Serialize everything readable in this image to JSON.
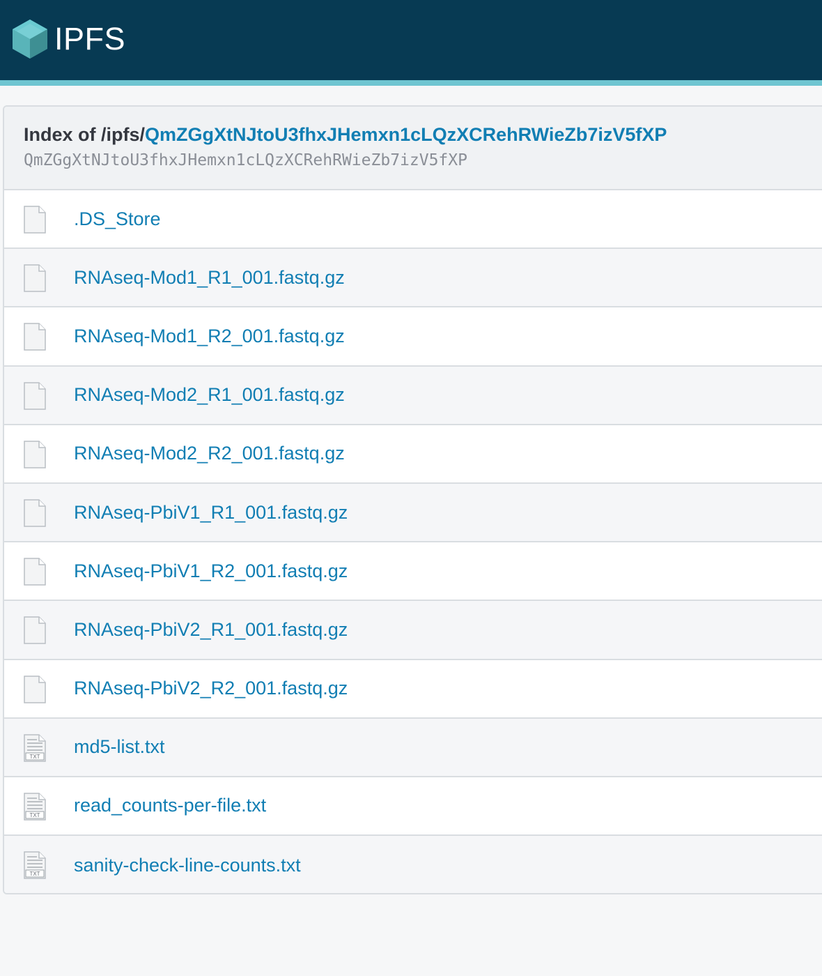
{
  "header": {
    "logo_text": "IPFS",
    "brand_color": "#073a53",
    "stripe_color": "#6fc5d1"
  },
  "index": {
    "prefix": "Index of /ipfs/",
    "cid_link": "QmZGgXtNJtoU3fhxJHemxn1cLQzXCRehRWieZb7izV5fXP",
    "cid_hash": "QmZGgXtNJtoU3fhxJHemxn1cLQzXCRehRWieZb7izV5fXP"
  },
  "files": [
    {
      "name": ".DS_Store",
      "icon": "file-icon"
    },
    {
      "name": "RNAseq-Mod1_R1_001.fastq.gz",
      "icon": "file-icon"
    },
    {
      "name": "RNAseq-Mod1_R2_001.fastq.gz",
      "icon": "file-icon"
    },
    {
      "name": "RNAseq-Mod2_R1_001.fastq.gz",
      "icon": "file-icon"
    },
    {
      "name": "RNAseq-Mod2_R2_001.fastq.gz",
      "icon": "file-icon"
    },
    {
      "name": "RNAseq-PbiV1_R1_001.fastq.gz",
      "icon": "file-icon"
    },
    {
      "name": "RNAseq-PbiV1_R2_001.fastq.gz",
      "icon": "file-icon"
    },
    {
      "name": "RNAseq-PbiV2_R1_001.fastq.gz",
      "icon": "file-icon"
    },
    {
      "name": "RNAseq-PbiV2_R2_001.fastq.gz",
      "icon": "file-icon"
    },
    {
      "name": "md5-list.txt",
      "icon": "txt-file-icon",
      "icon_label": "TXT"
    },
    {
      "name": "read_counts-per-file.txt",
      "icon": "txt-file-icon",
      "icon_label": "TXT"
    },
    {
      "name": "sanity-check-line-counts.txt",
      "icon": "txt-file-icon",
      "icon_label": "TXT"
    }
  ]
}
